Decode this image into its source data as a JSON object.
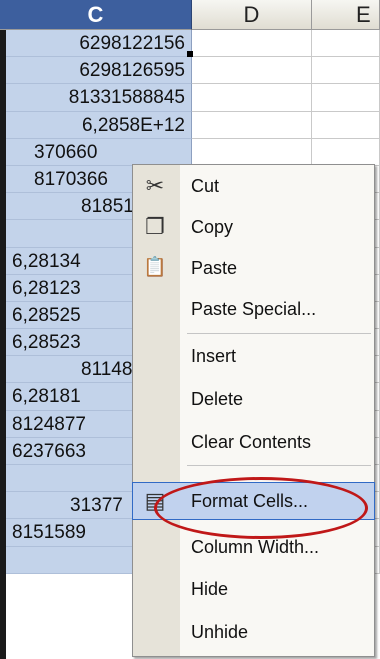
{
  "columns": [
    "C",
    "D",
    "E"
  ],
  "cells_c": [
    "6298122156",
    "6298126595",
    "81331588845",
    "6,2858E+12",
    "370660",
    "8170366",
    "81851",
    "",
    "6,28134",
    "6,28123",
    "6,28525",
    "6,28523",
    "81148",
    "6,28181",
    "8124877",
    "6237663",
    "",
    "31377",
    "8151589",
    ""
  ],
  "context_menu": {
    "items": [
      {
        "label": "Cut",
        "icon": "scissors-icon",
        "glyph": "✂"
      },
      {
        "label": "Copy",
        "icon": "copy-icon",
        "glyph": "❐"
      },
      {
        "label": "Paste",
        "icon": "paste-icon",
        "glyph": "📋"
      },
      {
        "label": "Paste Special...",
        "icon": "",
        "glyph": ""
      },
      {
        "label": "Insert",
        "icon": "",
        "glyph": ""
      },
      {
        "label": "Delete",
        "icon": "",
        "glyph": ""
      },
      {
        "label": "Clear Contents",
        "icon": "",
        "glyph": ""
      },
      {
        "label": "Format Cells...",
        "icon": "format-cells-icon",
        "glyph": "▤"
      },
      {
        "label": "Column Width...",
        "icon": "",
        "glyph": ""
      },
      {
        "label": "Hide",
        "icon": "",
        "glyph": ""
      },
      {
        "label": "Unhide",
        "icon": "",
        "glyph": ""
      }
    ],
    "highlighted": "Format Cells..."
  },
  "colors": {
    "selection": "#c3d3ea",
    "header_selected": "#3d5f9e",
    "highlight": "#c1d2ee",
    "annotation_circle": "#c01818"
  }
}
